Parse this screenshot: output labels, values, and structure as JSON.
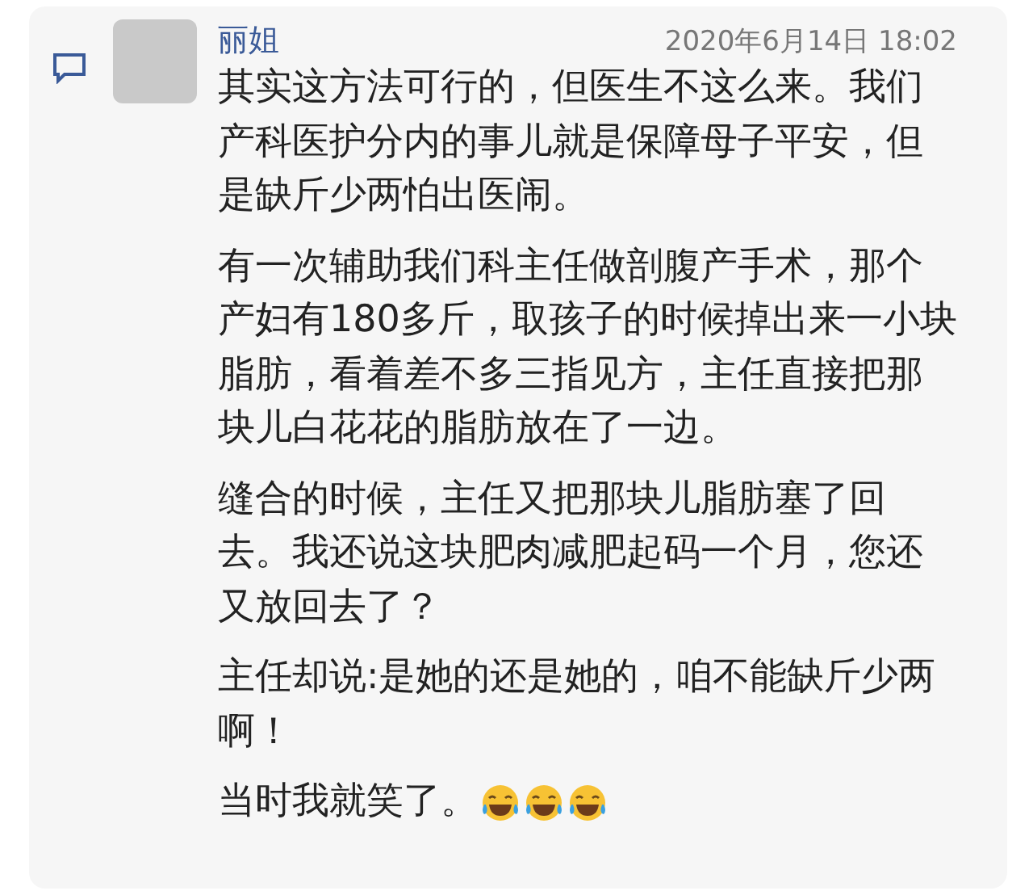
{
  "comment": {
    "author": "丽姐",
    "time": "2020年6月14日 18:02",
    "paragraphs": [
      "其实这方法可行的，但医生不这么来。我们产科医护分内的事儿就是保障母子平安，但是缺斤少两怕出医闹。",
      "有一次辅助我们科主任做剖腹产手术，那个产妇有180多斤，取孩子的时候掉出来一小块脂肪，看着差不多三指见方，主任直接把那块儿白花花的脂肪放在了一边。",
      "缝合的时候，主任又把那块儿脂肪塞了回去。我还说这块肥肉减肥起码一个月，您还又放回去了？",
      "主任却说:是她的还是她的，咱不能缺斤少两啊！",
      "当时我就笑了。"
    ]
  }
}
